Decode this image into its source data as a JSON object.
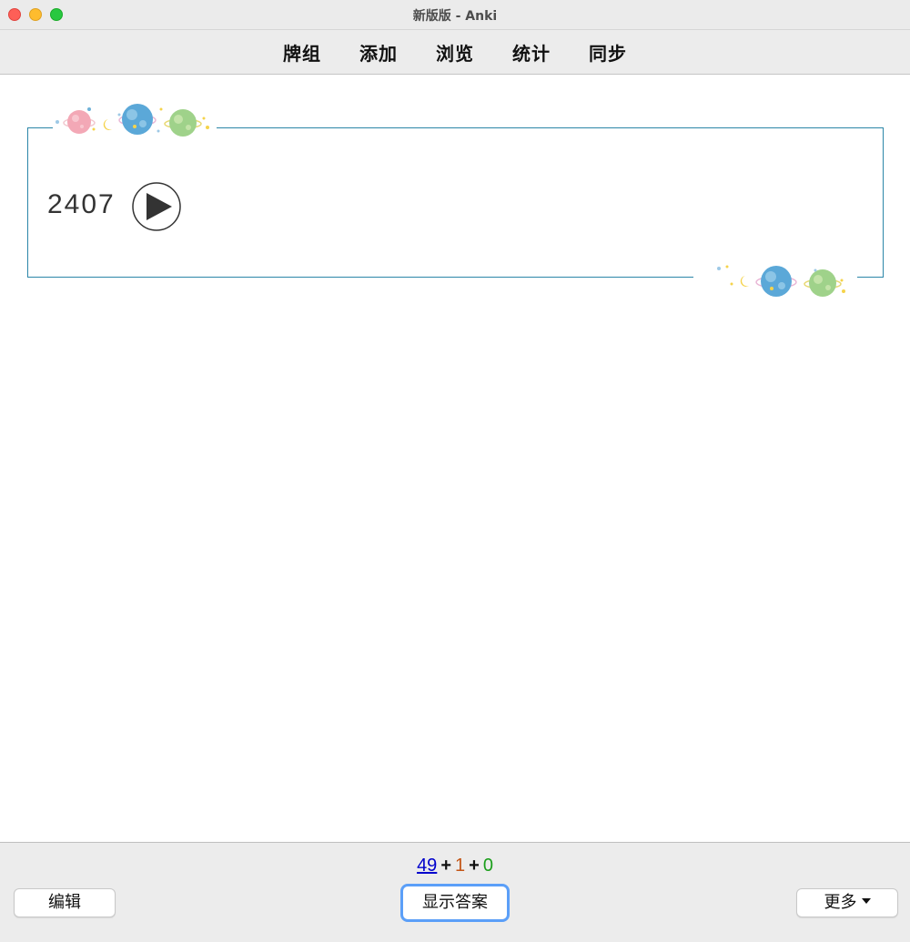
{
  "window": {
    "title": "新版版 - Anki"
  },
  "toolbar": {
    "items": [
      "牌组",
      "添加",
      "浏览",
      "统计",
      "同步"
    ]
  },
  "card": {
    "text": "2407",
    "audio_icon": "play-icon",
    "frame_color": "#2b86a8",
    "decoration": "planets-decoration"
  },
  "counts": {
    "new": "49",
    "plus1": "+",
    "learn": "1",
    "plus2": "+",
    "review": "0",
    "new_color": "#0000cc",
    "learn_color": "#c35617",
    "review_color": "#1a9e1a"
  },
  "bottombar": {
    "edit_label": "编辑",
    "show_answer_label": "显示答案",
    "more_label": "更多"
  }
}
